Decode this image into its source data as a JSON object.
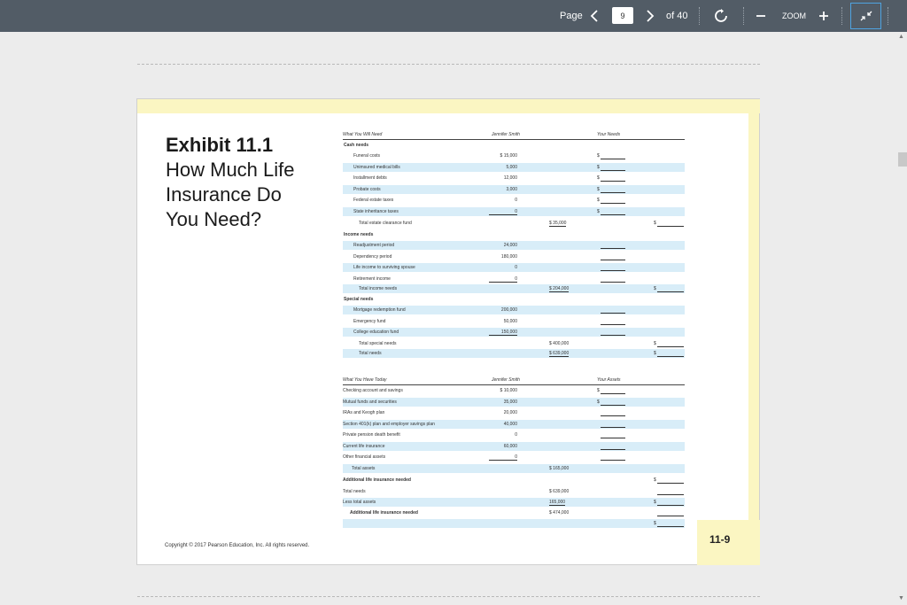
{
  "toolbar": {
    "page_label": "Page",
    "current_page": "9",
    "of_label": "of 40",
    "zoom_label": "ZOOM",
    "icons": [
      "chevron-left-icon",
      "chevron-right-icon",
      "rotate-icon",
      "minus-icon",
      "plus-icon",
      "exit-fullscreen-icon"
    ]
  },
  "slide": {
    "title_bold": "Exhibit 11.1",
    "title_line1": "How Much Life",
    "title_line2": "Insurance Do",
    "title_line3": "You Need?",
    "copyright": "Copyright © 2017 Pearson Education, Inc. All rights reserved.",
    "page_number": "11-9"
  },
  "table1": {
    "headers": {
      "item": "What You Will Need",
      "person": "Jennifer Smith",
      "yours": "Your Needs"
    },
    "sections": {
      "cash": "Cash needs",
      "income": "Income needs",
      "special": "Special needs"
    },
    "cash_rows": [
      {
        "label": "Funeral costs",
        "value": "$   15,000",
        "your": "$"
      },
      {
        "label": "Unimsured medical bills",
        "value": "5,000",
        "your": "$"
      },
      {
        "label": "Installment debts",
        "value": "12,000",
        "your": "$"
      },
      {
        "label": "Probate costs",
        "value": "3,000",
        "your": "$"
      },
      {
        "label": "Federal estate taxes",
        "value": "0",
        "your": "$"
      },
      {
        "label": "State inheritance taxes",
        "value": "0",
        "your": "$"
      }
    ],
    "cash_total": {
      "label": "Total estate clearance fund",
      "total": "$   35,000",
      "your": "$"
    },
    "income_rows": [
      {
        "label": "Readjustment period",
        "value": "24,000"
      },
      {
        "label": "Dependency period",
        "value": "180,000"
      },
      {
        "label": "Life income to surviving spouse",
        "value": "0"
      },
      {
        "label": "Retirement income",
        "value": "0"
      }
    ],
    "income_total": {
      "label": "Total income needs",
      "total": "$  204,000",
      "your": "$"
    },
    "special_rows": [
      {
        "label": "Mortgage redemption fund",
        "value": "200,000"
      },
      {
        "label": "Emergency fund",
        "value": "50,000"
      },
      {
        "label": "College education fund",
        "value": "150,000"
      }
    ],
    "special_total": {
      "label": "Total special needs",
      "total": "$  400,000",
      "your": "$"
    },
    "needs_total": {
      "label": "Total needs",
      "total": "$  639,000",
      "your": "$"
    }
  },
  "table2": {
    "headers": {
      "item": "What You Have Today",
      "person": "Jennifer Smith",
      "yours": "Your Assets"
    },
    "rows": [
      {
        "label": "Checking account and savings",
        "value": "$   10,000",
        "your": "$"
      },
      {
        "label": "Mutual funds and securities",
        "value": "35,000",
        "your": "$"
      },
      {
        "label": "IRAs and Keogh plan",
        "value": "20,000",
        "your": ""
      },
      {
        "label": "Section 401(k) plan and employer savings plan",
        "value": "40,000",
        "your": ""
      },
      {
        "label": "Private pension death benefit",
        "value": "0",
        "your": ""
      },
      {
        "label": "Current life insurance",
        "value": "60,000",
        "your": ""
      },
      {
        "label": "Other financial assets",
        "value": "0",
        "your": ""
      }
    ],
    "assets_total": {
      "label": "Total assets",
      "total": "$  165,000"
    },
    "additional_heading": "Additional life insurance needed",
    "summary": [
      {
        "label": "Total needs",
        "total": "$  639,000"
      },
      {
        "label": "Less total assets",
        "total": "165,000"
      },
      {
        "label": "Additional life insurance needed",
        "total": "$  474,000"
      }
    ],
    "dollar": "$"
  }
}
